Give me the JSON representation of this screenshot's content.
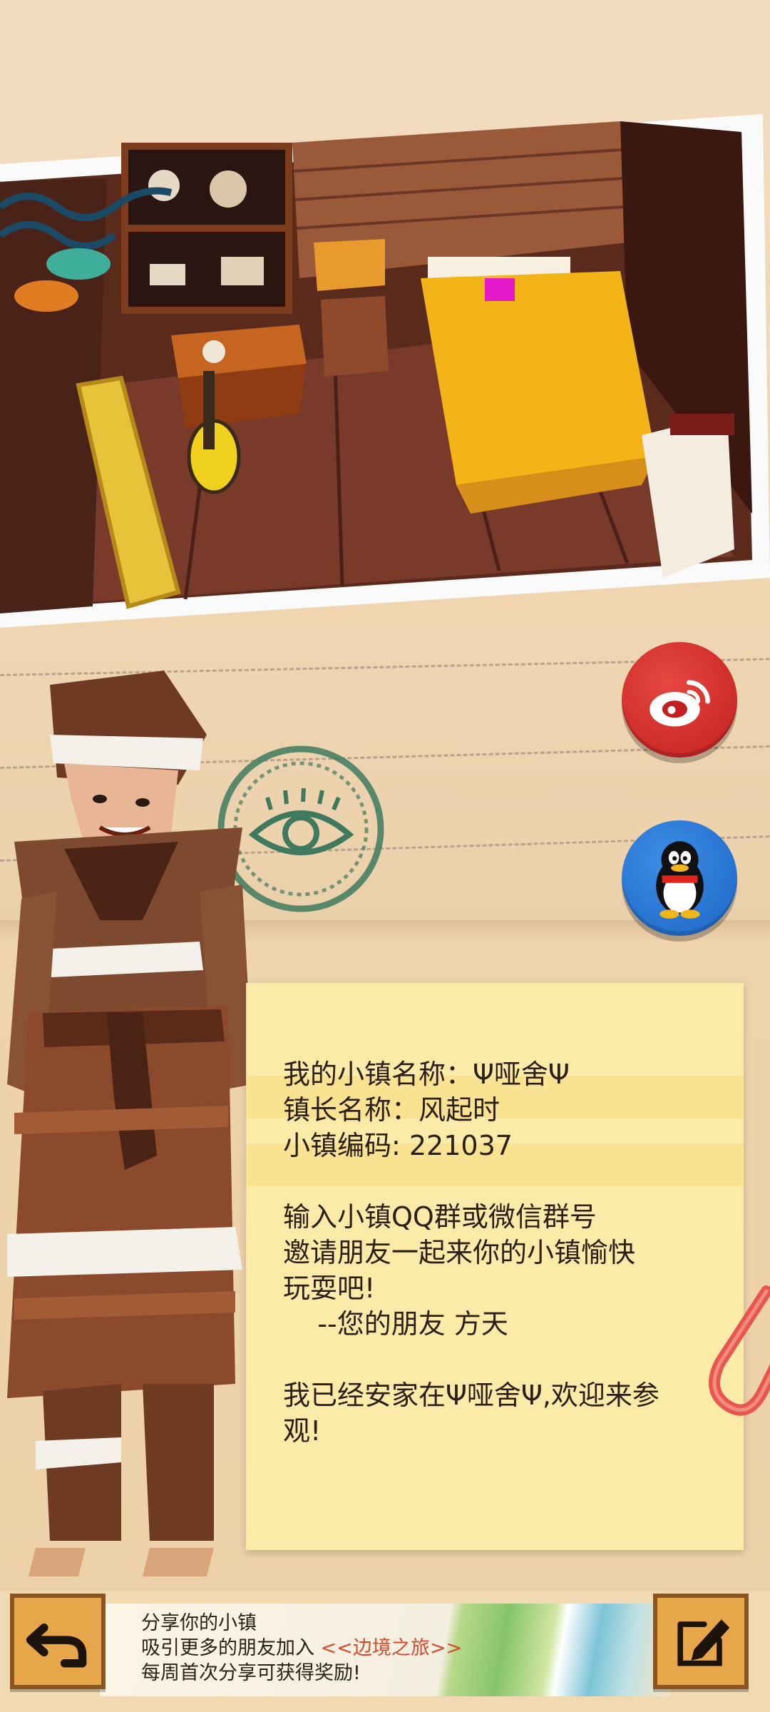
{
  "note": {
    "lines": [
      "我的小镇名称：Ψ哑舍Ψ",
      "镇长名称：风起时",
      "小镇编码: 221037",
      "",
      "输入小镇QQ群或微信群号",
      "邀请朋友一起来你的小镇愉快",
      "玩耍吧!",
      "    --您的朋友 方天",
      "",
      "我已经安家在Ψ哑舍Ψ,欢迎来参",
      "观!"
    ]
  },
  "bottom": {
    "line1": "分享你的小镇",
    "line2_prefix": "吸引更多的朋友加入 ",
    "line2_accent": "<<边境之旅>>",
    "line3": "每周首次分享可获得奖励!"
  },
  "icons": {
    "weibo": "weibo-icon",
    "qq": "qq-penguin-icon",
    "back": "back-arrow-icon",
    "edit": "edit-pencil-icon",
    "stamp": "eye-stamp-icon",
    "clip": "paper-clip-icon"
  },
  "colors": {
    "weibo": "#c21f1f",
    "qq": "#1d65c4",
    "note": "#fbeaa8",
    "accent": "#d44b2e"
  }
}
